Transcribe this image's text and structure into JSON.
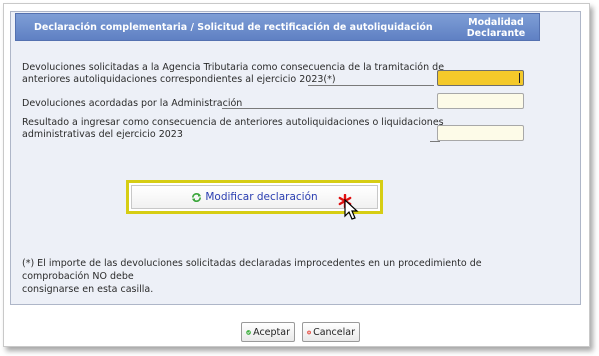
{
  "header": {
    "title": "Declaración complementaria / Solicitud de rectificación de autoliquidación",
    "column_line1": "Modalidad",
    "column_line2": "Declarante"
  },
  "rows": [
    {
      "line1": "Devoluciones solicitadas a la Agencia Tributaria como consecuencia de la tramitación de",
      "line2": "anteriores autoliquidaciones correspondientes al ejercicio 2023(*)",
      "value": ""
    },
    {
      "line1": "Devoluciones acordadas por la Administración",
      "value": ""
    },
    {
      "line1": "Resultado a ingresar como consecuencia de anteriores autoliquidaciones o liquidaciones",
      "line2": "administrativas del ejercicio 2023",
      "value": ""
    }
  ],
  "modify_button": {
    "label": "Modificar declaración",
    "icon": "refresh-icon"
  },
  "footnote": {
    "line1": "(*) El importe de las devoluciones solicitadas declaradas improcedentes en un procedimiento de comprobación NO debe",
    "line2": "consignarse en esta casilla."
  },
  "footer": {
    "accept_label": "Aceptar",
    "cancel_label": "Cancelar",
    "accept_icon": "check-icon",
    "cancel_icon": "cancel-icon"
  },
  "colors": {
    "header": "#6a8bcd",
    "active_field": "#f4c92a",
    "highlight_frame": "#d6cd14",
    "link_text": "#2a3eb1"
  }
}
